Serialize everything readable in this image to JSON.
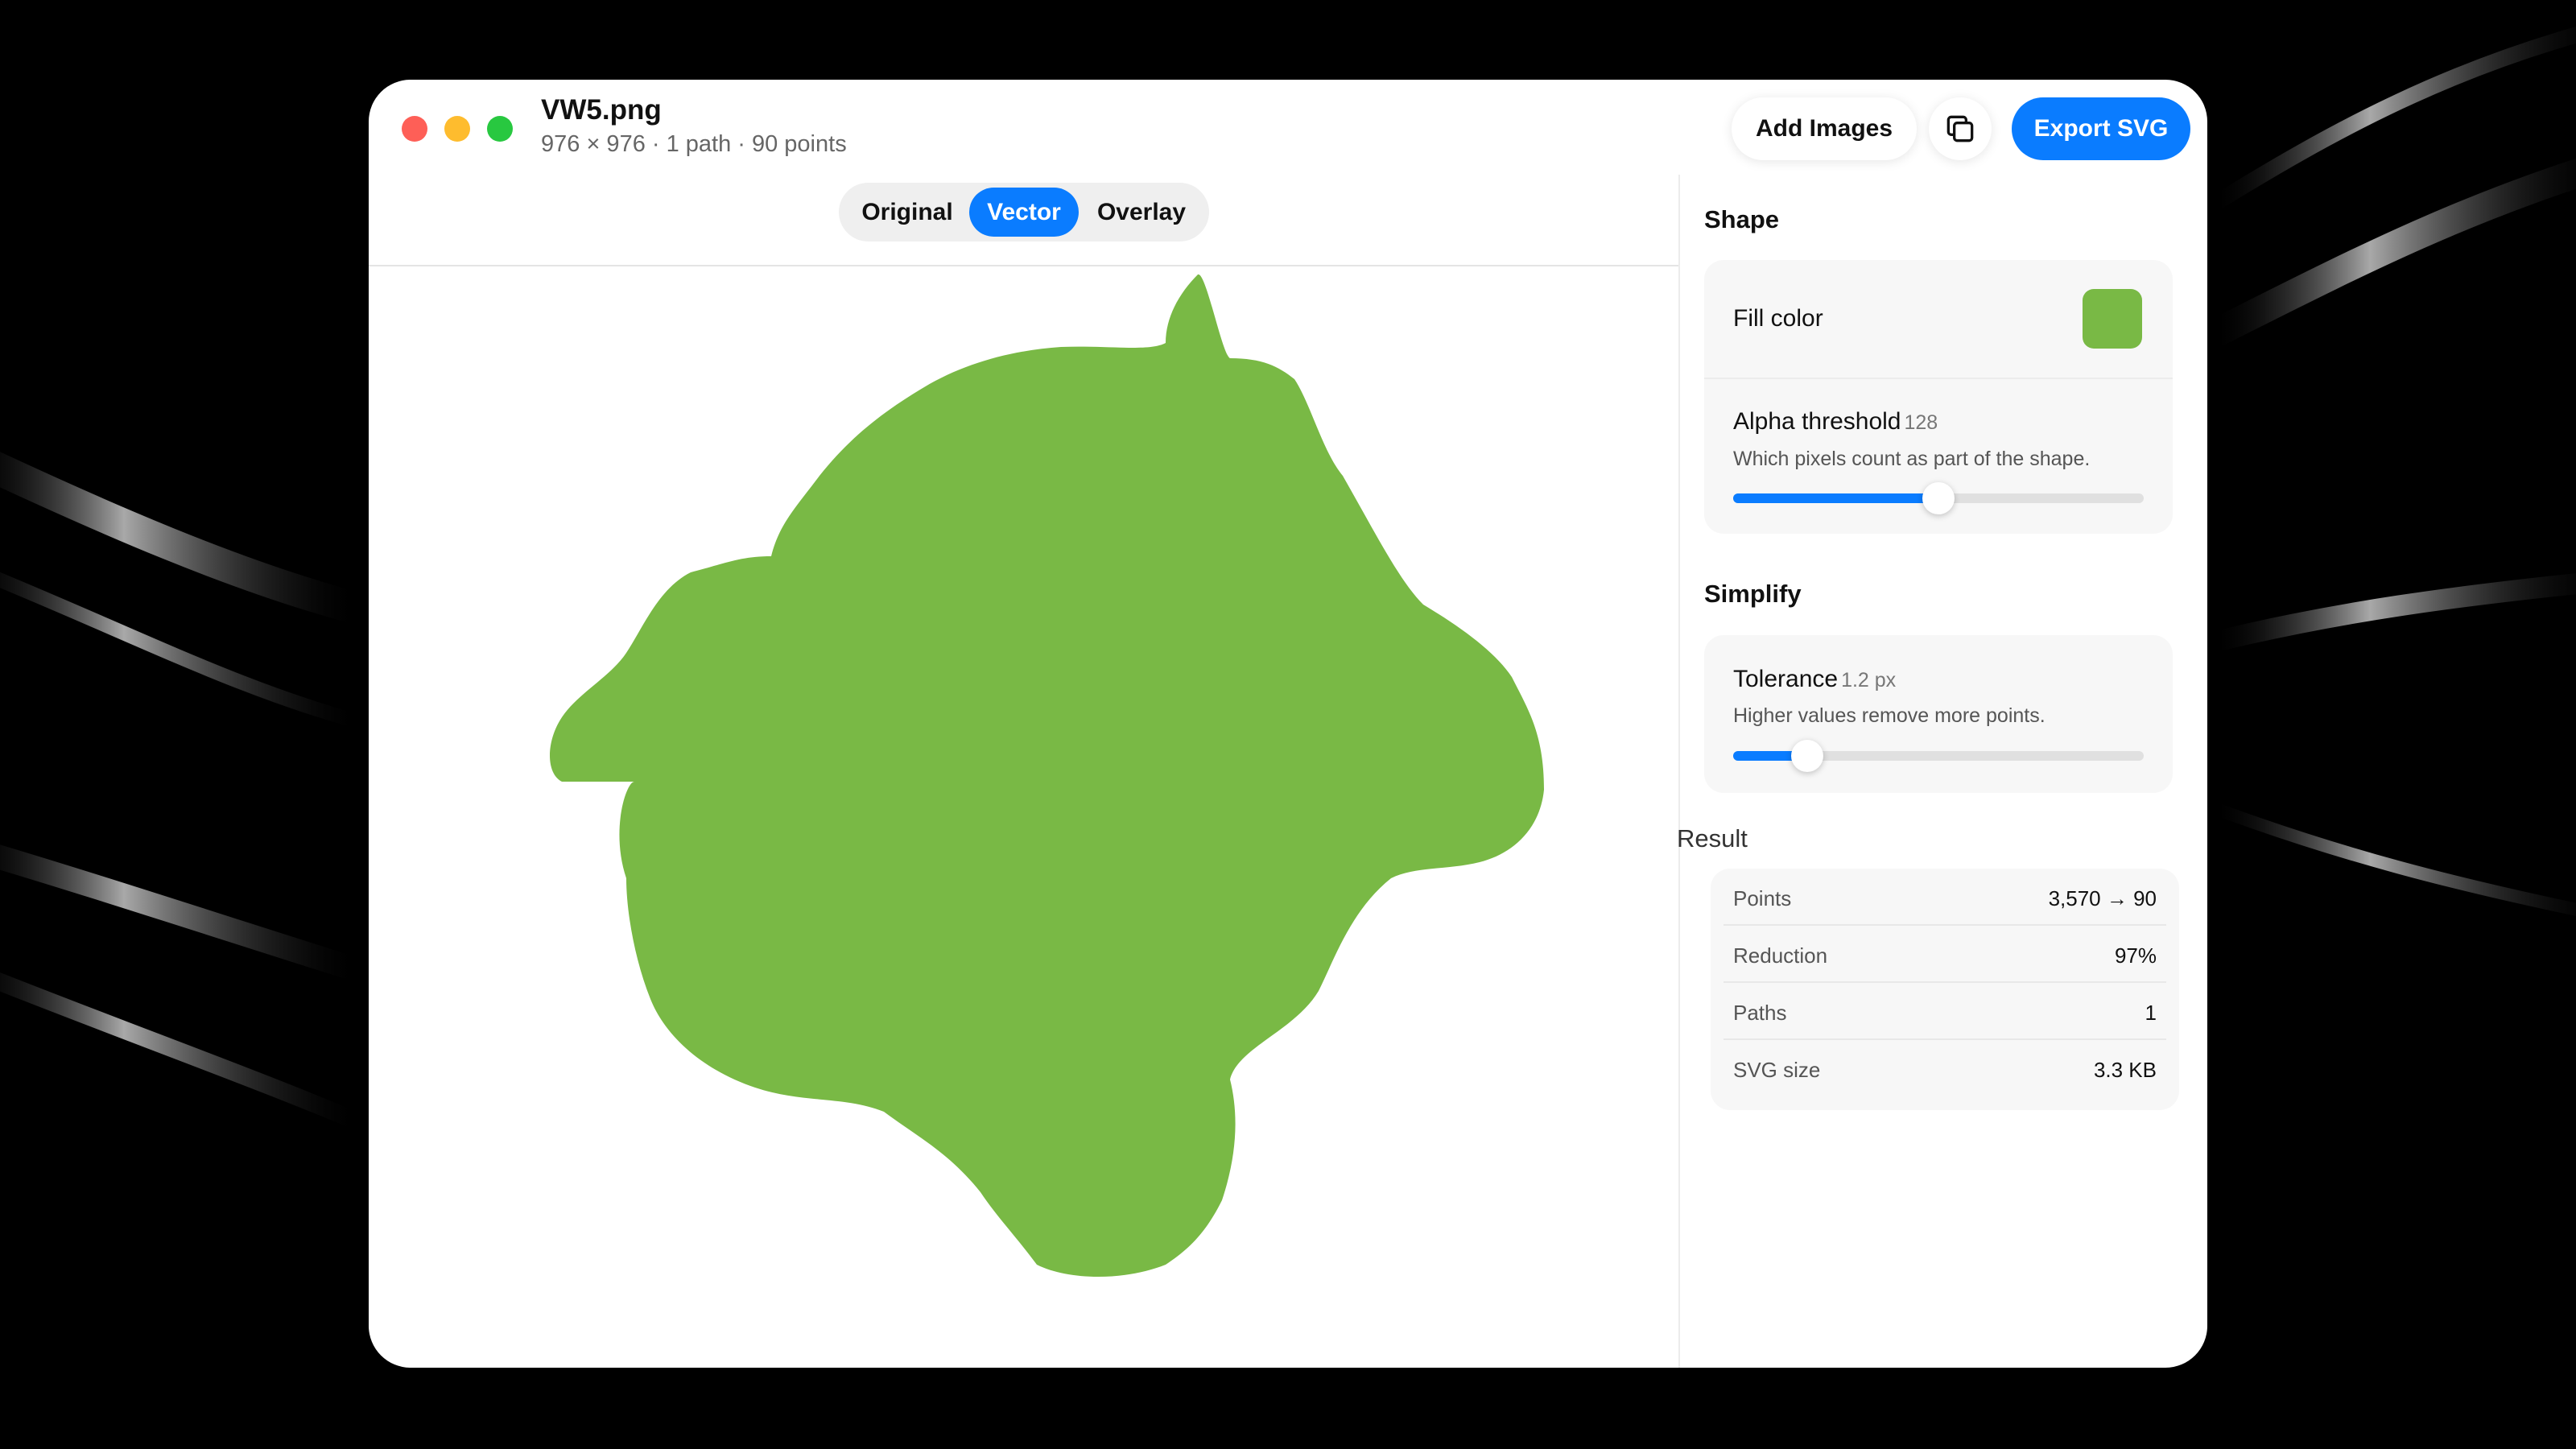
{
  "window": {
    "file_name": "VW5.png",
    "file_meta": "976 × 976 · 1 path · 90 points"
  },
  "toolbar": {
    "add_images_label": "Add Images",
    "copy_icon": "copy-icon",
    "export_label": "Export SVG"
  },
  "view_tabs": {
    "original": "Original",
    "vector": "Vector",
    "overlay": "Overlay",
    "selected": "Vector"
  },
  "shape_section": {
    "title": "Shape",
    "fill_label": "Fill color",
    "fill_color": "#79b945",
    "alpha_label": "Alpha threshold",
    "alpha_value": "128",
    "alpha_desc": "Which pixels count as part of the shape.",
    "alpha_fraction": 0.5
  },
  "simplify_section": {
    "title": "Simplify",
    "tolerance_label": "Tolerance",
    "tolerance_value": "1.2 px",
    "tolerance_desc": "Higher values remove more points.",
    "tolerance_fraction": 0.18
  },
  "result_section": {
    "title": "Result",
    "rows": [
      {
        "label": "Points",
        "value": "3,570 → 90"
      },
      {
        "label": "Reduction",
        "value": "97%"
      },
      {
        "label": "Paths",
        "value": "1"
      },
      {
        "label": "SVG size",
        "value": "3.3 KB"
      }
    ]
  },
  "colors": {
    "accent": "#0a7cff",
    "shape_fill": "#79b945",
    "close": "#fe5f57",
    "minimize": "#febc2e",
    "maximize": "#28c840"
  }
}
